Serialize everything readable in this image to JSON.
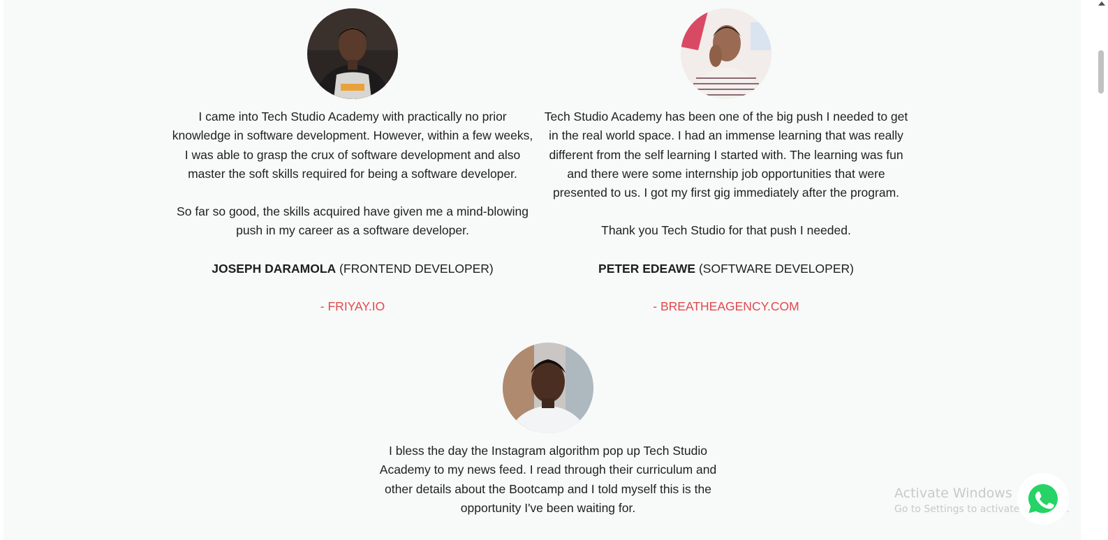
{
  "testimonials": [
    {
      "avatar_icon": "person-photo-avatar",
      "paragraphs": [
        "I came into Tech Studio Academy with practically no prior knowledge in software development. However, within a few weeks, I was able to grasp the crux of software development and also master the soft skills required for being a software developer.",
        "So far so good, the skills acquired have given me a mind-blowing push in my career as a software developer."
      ],
      "name": "JOSEPH DARAMOLA",
      "role": "(FRONTEND DEVELOPER)",
      "company": "- FRIYAY.IO"
    },
    {
      "avatar_icon": "person-photo-avatar",
      "paragraphs": [
        "Tech Studio Academy has been one of the big push I needed to get in the real world space. I had an immense learning that was really different from the self learning I started with. The learning was fun and there were some internship job opportunities that were presented to us. I got my first gig immediately after the program.",
        "Thank you Tech Studio for that push I needed."
      ],
      "name": "PETER EDEAWE",
      "role": "(SOFTWARE DEVELOPER)",
      "company": "- BREATHEAGENCY.COM"
    },
    {
      "avatar_icon": "person-photo-avatar",
      "paragraphs": [
        "I bless the day the Instagram algorithm pop up Tech Studio Academy to my news feed. I read through their curriculum and other details about the Bootcamp and I told myself this is the opportunity I've been waiting for."
      ]
    }
  ],
  "watermark": {
    "title": "Activate Windows",
    "subtitle": "Go to Settings to activate Windows."
  },
  "whatsapp": {
    "icon": "whatsapp-icon",
    "color": "#25d366"
  },
  "colors": {
    "accent": "#e2484b",
    "background": "#f8f9f9",
    "text": "#1f1f1f"
  }
}
